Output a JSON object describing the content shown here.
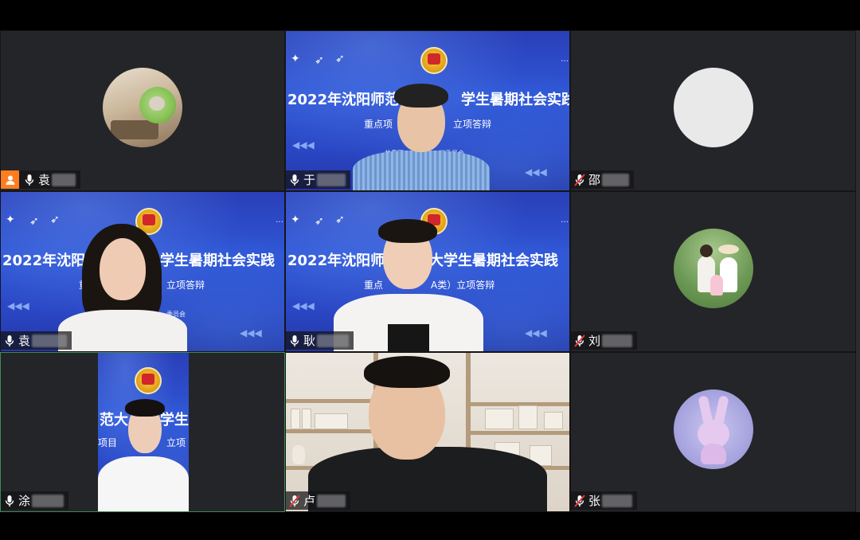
{
  "meeting": {
    "participants": [
      {
        "id": "p1",
        "name": "袁",
        "muted": false,
        "is_host": true,
        "video": false,
        "avatar": "room-plush-avatar"
      },
      {
        "id": "p2",
        "name": "于",
        "muted": false,
        "is_host": false,
        "video": true
      },
      {
        "id": "p3",
        "name": "邵",
        "muted": true,
        "is_host": false,
        "video": false,
        "avatar": "blank-avatar"
      },
      {
        "id": "p4",
        "name": "袁",
        "muted": false,
        "is_host": false,
        "video": true
      },
      {
        "id": "p5",
        "name": "耿",
        "muted": false,
        "is_host": false,
        "video": true
      },
      {
        "id": "p6",
        "name": "刘",
        "muted": true,
        "is_host": false,
        "video": false,
        "avatar": "family-photo-avatar"
      },
      {
        "id": "p7",
        "name": "涂",
        "muted": false,
        "is_host": false,
        "video": true,
        "active_speaker": true
      },
      {
        "id": "p8",
        "name": "卢",
        "muted": true,
        "is_host": false,
        "video": true
      },
      {
        "id": "p9",
        "name": "张",
        "muted": true,
        "is_host": false,
        "video": false,
        "avatar": "bunny-plush-avatar"
      }
    ]
  },
  "banner": {
    "title_p2": "2022年沈阳师范",
    "title_p2_end": "学生暑期社会实践",
    "sub_p2_a": "重点项",
    "sub_p2_b": "立项答辩",
    "org_p2_a": "共青团",
    "org_p2_b": "学委员会",
    "title_p4_a": "2022年沈阳师",
    "title_p4_b": "学生暑期社会实践",
    "sub_p4_a": "重点",
    "sub_p4_b": "）立项答辩",
    "org_p4": "委员会",
    "title_p5_a": "2022年沈阳师",
    "title_p5_b": "大学生暑期社会实践",
    "sub_p5_a": "重点",
    "sub_p5_b": "A类）立项答辩",
    "org_p5": "会",
    "title_p7_a": "范大",
    "title_p7_b": "学生",
    "sub_p7_a": "项目",
    "sub_p7_b": "立项"
  },
  "colors": {
    "tile_bg": "#242528",
    "banner_blue": "#2f56d6",
    "host_orange": "#ff7d1f",
    "muted_red": "#e23b3b",
    "active_border": "#3d8b58"
  }
}
